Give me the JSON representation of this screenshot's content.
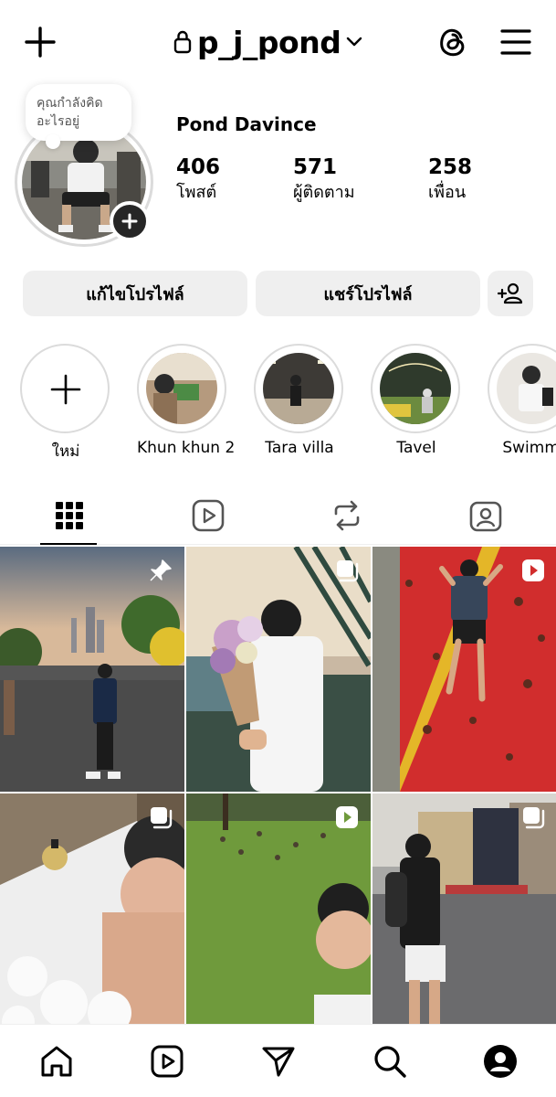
{
  "header": {
    "username": "p_j_pond",
    "icons": [
      "plus-icon",
      "lock-icon",
      "chevron-down-icon",
      "threads-icon",
      "menu-icon"
    ]
  },
  "profile": {
    "note": "คุณกำลังคิดอะไรอยู่",
    "display_name": "Pond Davince",
    "stats": [
      {
        "value": "406",
        "label": "โพสต์"
      },
      {
        "value": "571",
        "label": "ผู้ติดตาม"
      },
      {
        "value": "258",
        "label": "เพื่อน"
      }
    ]
  },
  "actions": {
    "edit_label": "แก้ไขโปรไฟล์",
    "share_label": "แชร์โปรไฟล์"
  },
  "highlights": [
    {
      "label": "ใหม่"
    },
    {
      "label": "Khun khun 2"
    },
    {
      "label": "Tara villa"
    },
    {
      "label": "Tavel"
    },
    {
      "label": "Swimmi"
    }
  ],
  "tabs": [
    "grid-icon",
    "reels-icon",
    "reposts-icon",
    "tagged-icon"
  ],
  "colors": {
    "button_bg": "#efefef",
    "divider": "#dbdbdb",
    "icon": "#000000"
  },
  "nav": [
    "home-icon",
    "reels-icon",
    "send-icon",
    "search-icon",
    "profile-icon"
  ]
}
